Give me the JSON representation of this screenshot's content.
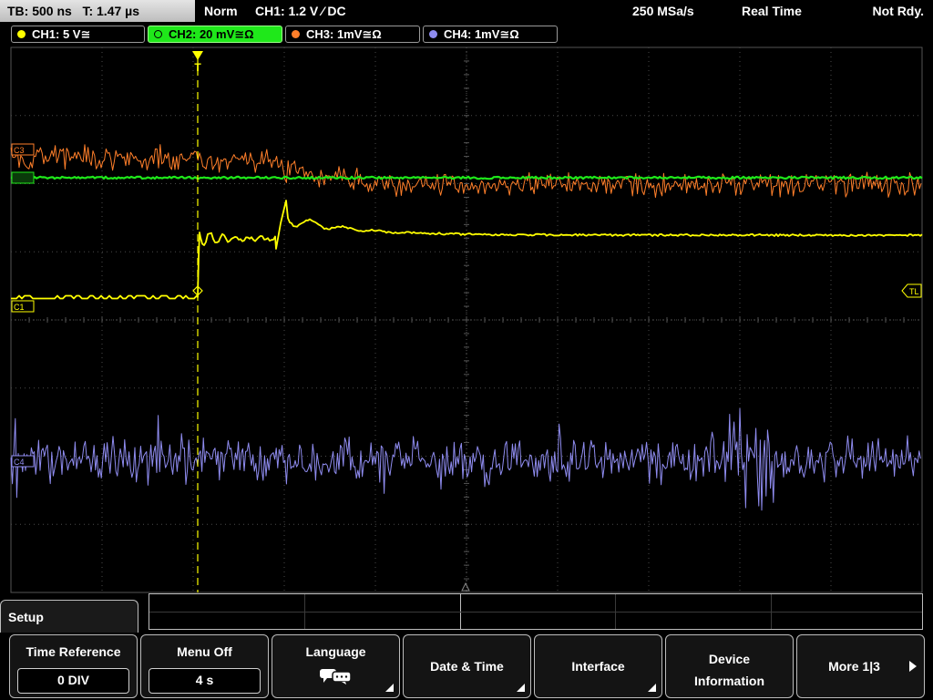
{
  "header": {
    "timebase": "TB: 500 ns   T: 1.47 µs",
    "mode": "Norm",
    "trigger": "CH1: 1.2 V ⁄ DC",
    "sample_rate": "250 MSa/s",
    "acq_mode": "Real Time",
    "status": "Not Rdy."
  },
  "channels": [
    {
      "label": "CH1: 5 V≅",
      "color": "#ffff00"
    },
    {
      "label": "CH2: 20 mV≅Ω",
      "color": "#1fe81a",
      "active": true
    },
    {
      "label": "CH3: 1mV≅Ω",
      "color": "#ff7f2a"
    },
    {
      "label": "CH4: 1mV≅Ω",
      "color": "#8f8cf0"
    }
  ],
  "markers": {
    "c3": "C3",
    "c1": "C1",
    "c4": "C4",
    "trigger_level": "TL",
    "trigger_pos": "T"
  },
  "menu": {
    "title": "Setup",
    "keys": [
      {
        "title": "Time Reference",
        "value": "0 DIV"
      },
      {
        "title": "Menu Off",
        "value": "4 s"
      },
      {
        "title": "Language",
        "icon": "speech-bubbles-icon"
      },
      {
        "line1": "Date & Time"
      },
      {
        "line1": "Interface"
      },
      {
        "line1": "Device",
        "line2": "Information"
      },
      {
        "line1": "More 1|3"
      }
    ]
  },
  "colors": {
    "ch1": "#ffff00",
    "ch2": "#1fe81a",
    "ch3": "#ff7f2a",
    "ch4": "#8f8cf0",
    "grid": "#4a4a4a"
  }
}
